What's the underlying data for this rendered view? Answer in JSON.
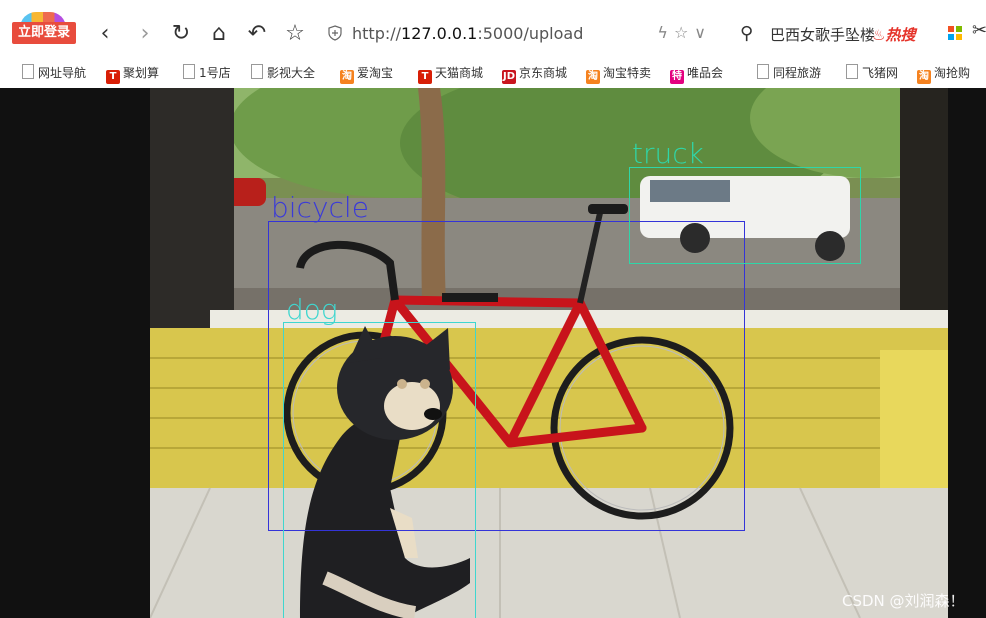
{
  "toolbar": {
    "login_label": "立即登录",
    "url_prefix": "http://",
    "url_host": "127.0.0.1",
    "url_rest": ":5000/upload",
    "search_text": "巴西女歌手坠楼",
    "hot_label": "热搜",
    "icons": [
      "back-icon",
      "forward-icon",
      "reload-icon",
      "home-icon",
      "undo-icon",
      "star-icon",
      "shield-icon",
      "search-icon",
      "scissors-icon"
    ]
  },
  "bookmarks": [
    {
      "label": "网址导航",
      "icon": "doc"
    },
    {
      "label": "聚划算",
      "icon": "T",
      "color": "#d81e06"
    },
    {
      "label": "1号店",
      "icon": "doc"
    },
    {
      "label": "影视大全",
      "icon": "doc"
    },
    {
      "label": "爱淘宝",
      "icon": "淘",
      "color": "#f5821f"
    },
    {
      "label": "天猫商城",
      "icon": "T",
      "color": "#d81e06"
    },
    {
      "label": "京东商城",
      "icon": "JD",
      "color": "#c9151e"
    },
    {
      "label": "淘宝特卖",
      "icon": "淘",
      "color": "#f5821f"
    },
    {
      "label": "唯品会",
      "icon": "特",
      "color": "#e4007f"
    },
    {
      "label": "同程旅游",
      "icon": "doc"
    },
    {
      "label": "飞猪网",
      "icon": "doc"
    },
    {
      "label": "淘抢购",
      "icon": "淘",
      "color": "#f5821f"
    }
  ],
  "detections": [
    {
      "label": "bicycle",
      "color": "#3434d8"
    },
    {
      "label": "dog",
      "color": "#3fd6cf"
    },
    {
      "label": "truck",
      "color": "#2fd6a8"
    }
  ],
  "watermark": "CSDN @刘润森！"
}
